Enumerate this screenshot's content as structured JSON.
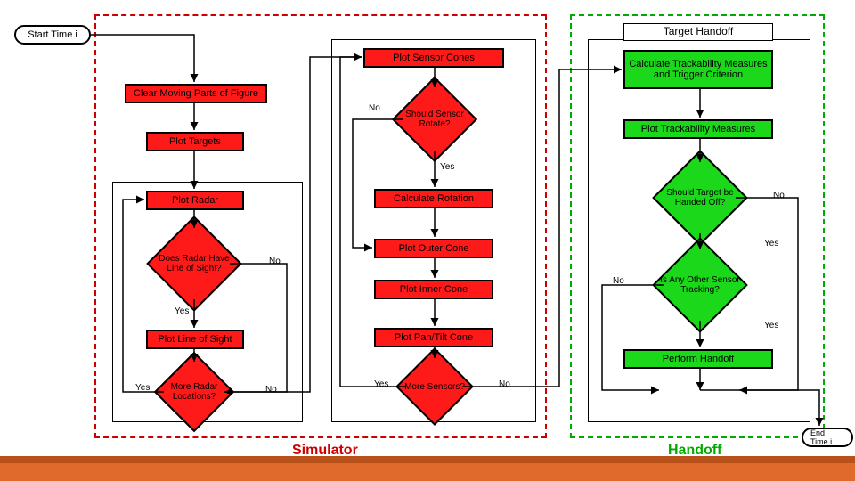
{
  "terminators": {
    "start": "Start Time i",
    "end": "End Time i"
  },
  "dashed_groups": {
    "simulator_label": "Simulator",
    "handoff_label": "Handoff"
  },
  "sensor_group_title": "Target Handoff",
  "boxes": {
    "clear_moving": "Clear Moving Parts of Figure",
    "plot_targets": "Plot Targets",
    "plot_radar": "Plot Radar",
    "plot_line_of_sight": "Plot Line of Sight",
    "plot_sensor_cones": "Plot Sensor Cones",
    "calc_rotation": "Calculate Rotation",
    "plot_outer_cone": "Plot Outer Cone",
    "plot_inner_cone": "Plot Inner Cone",
    "plot_pantilt": "Plot Pan/Tilt Cone",
    "calc_trackability": "Calculate Trackability Measures and Trigger Criterion",
    "plot_trackability": "Plot Trackability Measures",
    "perform_handoff": "Perform Handoff"
  },
  "diamonds": {
    "radar_los": "Does Radar Have Line of Sight?",
    "more_radar": "More Radar Locations?",
    "sensor_rotate": "Should Sensor Rotate?",
    "more_sensors": "More Sensors?",
    "target_handed": "Should Target be Handed Off?",
    "any_other_tracking": "Is Any Other Sensor Tracking?"
  },
  "edge_labels": {
    "yes": "Yes",
    "no": "No"
  },
  "chart_data": {
    "type": "flowchart",
    "nodes": [
      {
        "id": "start",
        "type": "terminator",
        "label": "Start Time i"
      },
      {
        "id": "clear",
        "type": "process",
        "label": "Clear Moving Parts of Figure"
      },
      {
        "id": "plot_targets",
        "type": "process",
        "label": "Plot Targets"
      },
      {
        "id": "plot_radar",
        "type": "process",
        "label": "Plot Radar"
      },
      {
        "id": "radar_los",
        "type": "decision",
        "label": "Does Radar Have Line of Sight?"
      },
      {
        "id": "plot_los",
        "type": "process",
        "label": "Plot Line of Sight"
      },
      {
        "id": "more_radar",
        "type": "decision",
        "label": "More Radar Locations?"
      },
      {
        "id": "plot_sensor_cones",
        "type": "process",
        "label": "Plot Sensor Cones"
      },
      {
        "id": "sensor_rotate",
        "type": "decision",
        "label": "Should Sensor Rotate?"
      },
      {
        "id": "calc_rotation",
        "type": "process",
        "label": "Calculate Rotation"
      },
      {
        "id": "plot_outer",
        "type": "process",
        "label": "Plot Outer Cone"
      },
      {
        "id": "plot_inner",
        "type": "process",
        "label": "Plot Inner Cone"
      },
      {
        "id": "plot_pantilt",
        "type": "process",
        "label": "Plot Pan/Tilt Cone"
      },
      {
        "id": "more_sensors",
        "type": "decision",
        "label": "More Sensors?"
      },
      {
        "id": "target_handoff_title",
        "type": "title",
        "label": "Target Handoff"
      },
      {
        "id": "calc_track",
        "type": "process",
        "label": "Calculate Trackability Measures and Trigger Criterion"
      },
      {
        "id": "plot_track",
        "type": "process",
        "label": "Plot Trackability Measures"
      },
      {
        "id": "target_handed",
        "type": "decision",
        "label": "Should Target be Handed Off?"
      },
      {
        "id": "any_other",
        "type": "decision",
        "label": "Is Any Other Sensor Tracking?"
      },
      {
        "id": "perform_handoff",
        "type": "process",
        "label": "Perform Handoff"
      },
      {
        "id": "end",
        "type": "terminator",
        "label": "End Time i"
      }
    ],
    "edges": [
      {
        "from": "start",
        "to": "clear"
      },
      {
        "from": "clear",
        "to": "plot_targets"
      },
      {
        "from": "plot_targets",
        "to": "plot_radar"
      },
      {
        "from": "plot_radar",
        "to": "radar_los"
      },
      {
        "from": "radar_los",
        "to": "plot_los",
        "label": "Yes"
      },
      {
        "from": "radar_los",
        "to": "more_radar",
        "label": "No"
      },
      {
        "from": "plot_los",
        "to": "more_radar"
      },
      {
        "from": "more_radar",
        "to": "plot_radar",
        "label": "Yes"
      },
      {
        "from": "more_radar",
        "to": "plot_sensor_cones",
        "label": "No"
      },
      {
        "from": "plot_sensor_cones",
        "to": "sensor_rotate"
      },
      {
        "from": "sensor_rotate",
        "to": "calc_rotation",
        "label": "Yes"
      },
      {
        "from": "sensor_rotate",
        "to": "plot_outer",
        "label": "No"
      },
      {
        "from": "calc_rotation",
        "to": "plot_outer"
      },
      {
        "from": "plot_outer",
        "to": "plot_inner"
      },
      {
        "from": "plot_inner",
        "to": "plot_pantilt"
      },
      {
        "from": "plot_pantilt",
        "to": "more_sensors"
      },
      {
        "from": "more_sensors",
        "to": "plot_sensor_cones",
        "label": "Yes"
      },
      {
        "from": "more_sensors",
        "to": "calc_track",
        "label": "No"
      },
      {
        "from": "calc_track",
        "to": "plot_track"
      },
      {
        "from": "plot_track",
        "to": "target_handed"
      },
      {
        "from": "target_handed",
        "to": "any_other",
        "label": "Yes"
      },
      {
        "from": "target_handed",
        "to": "end",
        "label": "No"
      },
      {
        "from": "any_other",
        "to": "perform_handoff",
        "label": "Yes"
      },
      {
        "from": "any_other",
        "to": "end",
        "label": "No"
      },
      {
        "from": "perform_handoff",
        "to": "end"
      }
    ],
    "groups": [
      {
        "id": "simulator",
        "label": "Simulator",
        "style": "dashed-red",
        "contains": [
          "clear",
          "plot_targets",
          "plot_radar",
          "radar_los",
          "plot_los",
          "more_radar",
          "plot_sensor_cones",
          "sensor_rotate",
          "calc_rotation",
          "plot_outer",
          "plot_inner",
          "plot_pantilt",
          "more_sensors"
        ]
      },
      {
        "id": "handoff",
        "label": "Handoff",
        "style": "dashed-green",
        "contains": [
          "calc_track",
          "plot_track",
          "target_handed",
          "any_other",
          "perform_handoff"
        ]
      }
    ]
  }
}
